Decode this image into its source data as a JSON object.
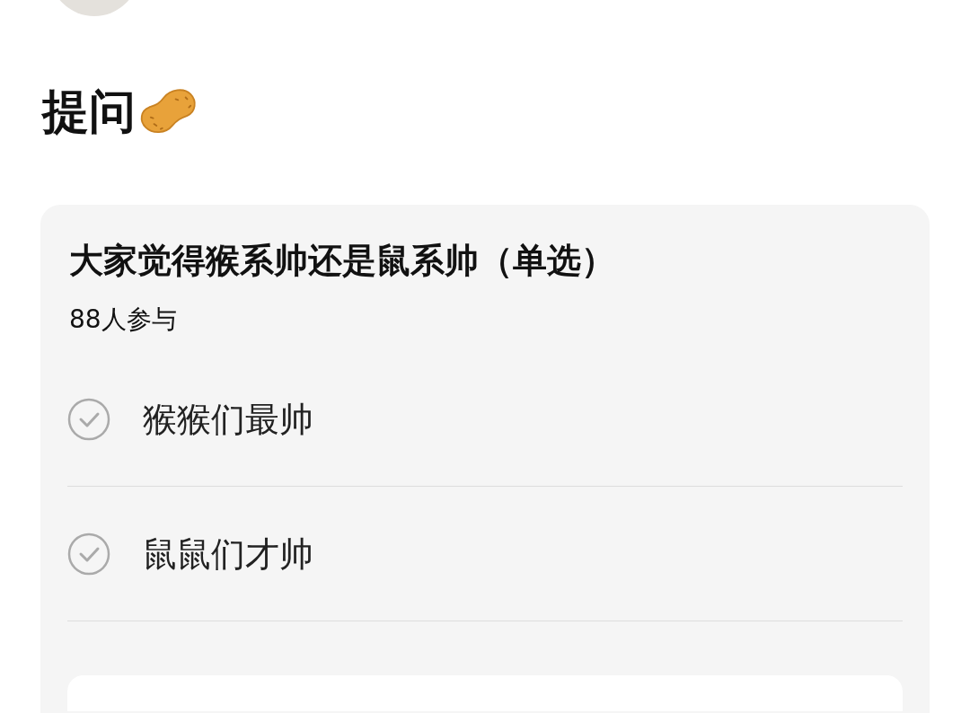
{
  "post": {
    "title": "提问"
  },
  "poll": {
    "question": "大家觉得猴系帅还是鼠系帅（单选）",
    "participants": "88人参与",
    "options": [
      {
        "label": "猴猴们最帅",
        "selected": false
      },
      {
        "label": "鼠鼠们才帅",
        "selected": false
      }
    ]
  }
}
